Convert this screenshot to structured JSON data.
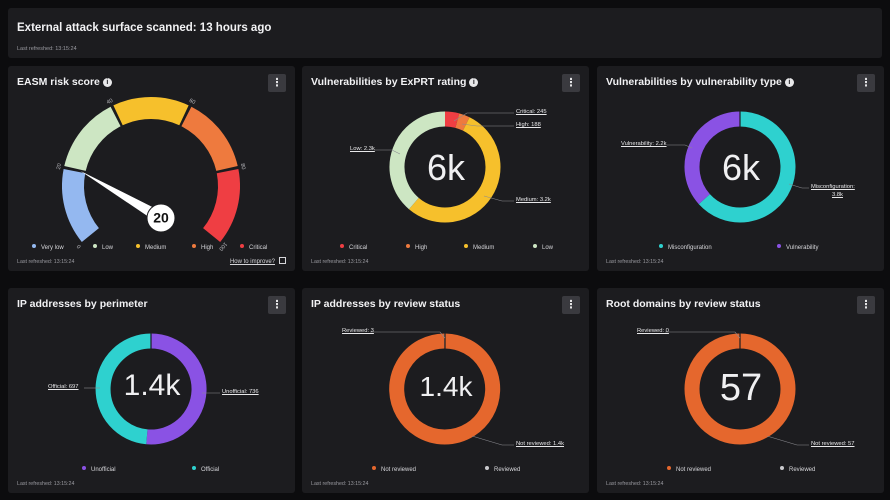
{
  "banner": {
    "title": "External attack surface scanned: 13 hours ago",
    "last_refreshed": "Last refreshed: 13:15:24"
  },
  "colors": {
    "very_low": "#94b8f0",
    "low": "#cde6c3",
    "medium": "#f6c02c",
    "high": "#ee7a3e",
    "critical": "#ef3e43",
    "misconfiguration": "#2ed1cf",
    "vulnerability": "#8a52e4",
    "not_reviewed": "#e5672d",
    "reviewed": "#c8c8cc"
  },
  "risk_score": {
    "title": "EASM risk score",
    "score": "20",
    "score_value": 20,
    "ticks": [
      "0",
      "20",
      "40",
      "60",
      "80",
      "100"
    ],
    "legend": [
      "Very low",
      "Low",
      "Medium",
      "High",
      "Critical"
    ],
    "last_refreshed": "Last refreshed: 13:15:24",
    "improve_link": "How to improve?"
  },
  "exprt": {
    "title": "Vulnerabilities by ExPRT rating",
    "center": "6k",
    "labels": {
      "critical": "Critical: 245",
      "high": "High: 188",
      "medium": "Medium: 3.2k",
      "low": "Low: 2.3k"
    },
    "legend": [
      "Critical",
      "High",
      "Medium",
      "Low"
    ],
    "last_refreshed": "Last refreshed: 13:15:24"
  },
  "vuln_type": {
    "title": "Vulnerabilities by vulnerability type",
    "center": "6k",
    "labels": {
      "vulnerability": "Vulnerability: 2.2k",
      "misconfig_line1": "Misconfiguration:",
      "misconfig_line2": "3.8k"
    },
    "legend": [
      "Misconfiguration",
      "Vulnerability"
    ],
    "last_refreshed": "Last refreshed: 13:15:24"
  },
  "ip_perimeter": {
    "title": "IP addresses by perimeter",
    "center": "1.4k",
    "labels": {
      "official": "Official: 697",
      "unofficial": "Unofficial: 736"
    },
    "legend": [
      "Unofficial",
      "Official"
    ],
    "last_refreshed": "Last refreshed: 13:15:24"
  },
  "ip_review": {
    "title": "IP addresses by review status",
    "center": "1.4k",
    "labels": {
      "reviewed": "Reviewed: 3",
      "not_reviewed": "Not reviewed: 1.4k"
    },
    "legend": [
      "Not reviewed",
      "Reviewed"
    ],
    "last_refreshed": "Last refreshed: 13:15:24"
  },
  "root_review": {
    "title": "Root domains by review status",
    "center": "57",
    "labels": {
      "reviewed": "Reviewed: 0",
      "not_reviewed": "Not reviewed: 57"
    },
    "legend": [
      "Not reviewed",
      "Reviewed"
    ],
    "last_refreshed": "Last refreshed: 13:15:24"
  },
  "chart_data": [
    {
      "type": "gauge",
      "title": "EASM risk score",
      "value": 20,
      "range": [
        0,
        100
      ],
      "bands": [
        "Very low",
        "Low",
        "Medium",
        "High",
        "Critical"
      ]
    },
    {
      "type": "pie",
      "title": "Vulnerabilities by ExPRT rating",
      "categories": [
        "Critical",
        "High",
        "Medium",
        "Low"
      ],
      "values": [
        245,
        188,
        3200,
        2300
      ]
    },
    {
      "type": "pie",
      "title": "Vulnerabilities by vulnerability type",
      "categories": [
        "Misconfiguration",
        "Vulnerability"
      ],
      "values": [
        3800,
        2200
      ]
    },
    {
      "type": "pie",
      "title": "IP addresses by perimeter",
      "categories": [
        "Unofficial",
        "Official"
      ],
      "values": [
        736,
        697
      ]
    },
    {
      "type": "pie",
      "title": "IP addresses by review status",
      "categories": [
        "Not reviewed",
        "Reviewed"
      ],
      "values": [
        1400,
        3
      ]
    },
    {
      "type": "pie",
      "title": "Root domains by review status",
      "categories": [
        "Not reviewed",
        "Reviewed"
      ],
      "values": [
        57,
        0
      ]
    }
  ]
}
